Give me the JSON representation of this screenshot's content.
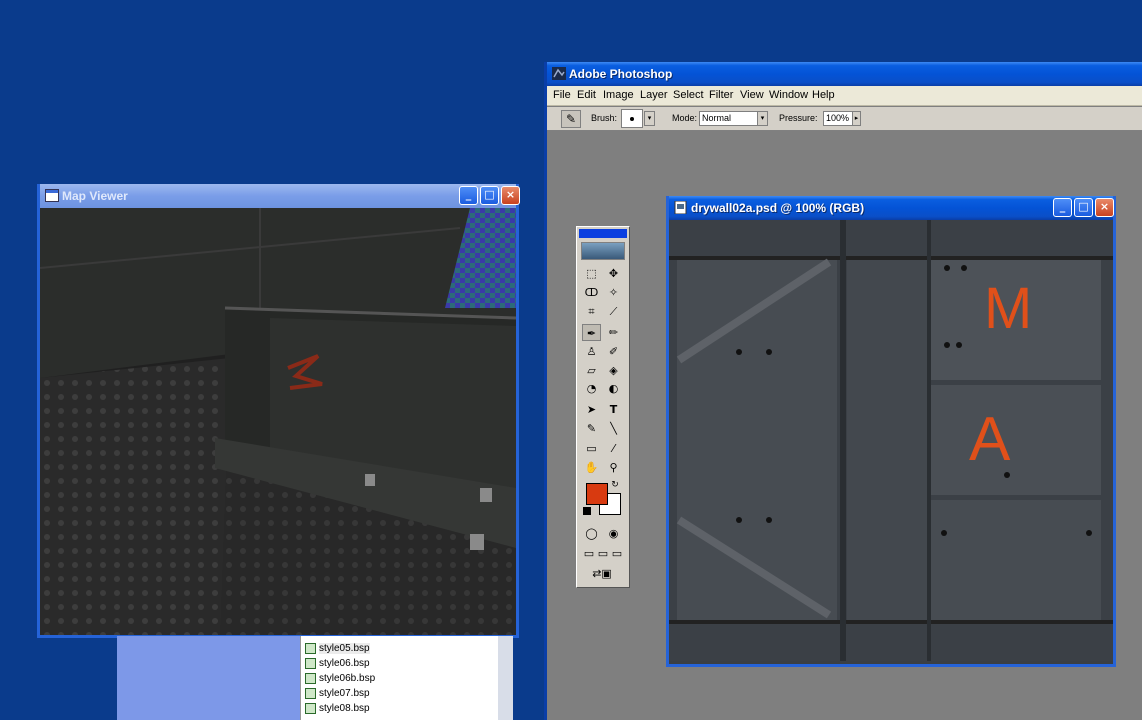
{
  "desktop": {
    "background": "#0a3b8c"
  },
  "map_viewer": {
    "title": "Map Viewer",
    "buttons": [
      "minimize",
      "maximize",
      "close"
    ]
  },
  "file_list": {
    "items": [
      {
        "name": "style05.bsp",
        "selected": true
      },
      {
        "name": "style06.bsp"
      },
      {
        "name": "style06b.bsp"
      },
      {
        "name": "style07.bsp"
      },
      {
        "name": "style08.bsp"
      }
    ]
  },
  "photoshop": {
    "title": "Adobe Photoshop",
    "menu": [
      "File",
      "Edit",
      "Image",
      "Layer",
      "Select",
      "Filter",
      "View",
      "Window",
      "Help"
    ],
    "options": {
      "brush_label": "Brush:",
      "mode_label": "Mode:",
      "mode_value": "Normal",
      "pressure_label": "Pressure:",
      "pressure_value": "100%"
    },
    "foreground_color": "#d83a10",
    "background_color": "#ffffff"
  },
  "document": {
    "title": "drywall02a.psd @ 100% (RGB)",
    "letters": [
      "M",
      "A"
    ]
  }
}
